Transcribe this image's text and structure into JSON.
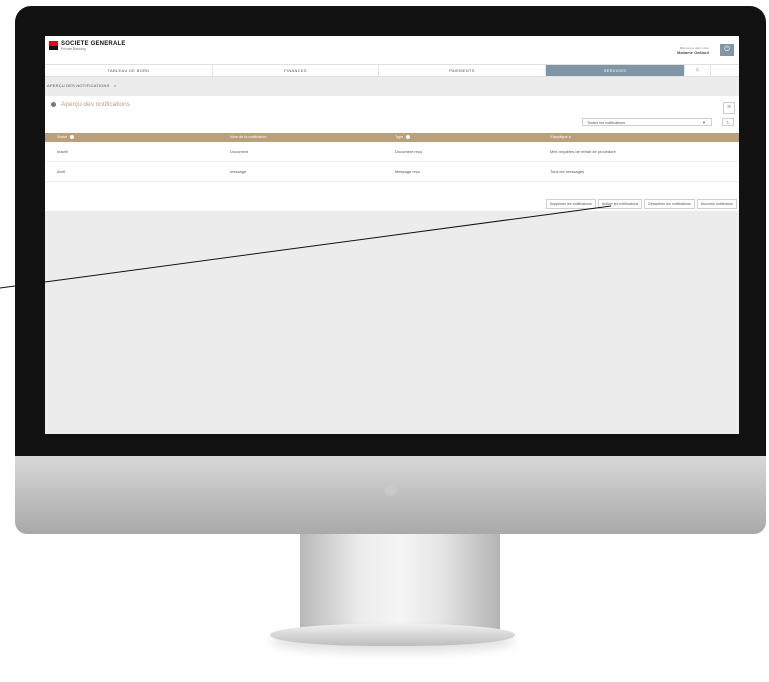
{
  "brand": {
    "name": "SOCIETE GENERALE",
    "subtitle": "Private Banking",
    "accent": "#e2001a"
  },
  "user": {
    "greeting": "Bienvenue dans votre",
    "name": "Madame Gaillard"
  },
  "nav": {
    "tabs": [
      {
        "label": "TABLEAU DE BORD",
        "active": false
      },
      {
        "label": "FINANCES",
        "active": false
      },
      {
        "label": "PAIEMENTS",
        "active": false
      },
      {
        "label": "SERVICES",
        "active": true
      }
    ],
    "home_icon": "home-icon",
    "active_color": "#7f96a6"
  },
  "breadcrumb": {
    "text": "APERÇU DES NOTIFICATIONS",
    "separator": ">"
  },
  "card": {
    "title": "Aperçu des notifications",
    "filter_value": "Toutes les notifications"
  },
  "table": {
    "header_color": "#b9a07a",
    "columns": [
      "Statut",
      "Nom de la notification",
      "Type",
      "S'applique à"
    ],
    "rows": [
      [
        "Inactif",
        "Document",
        "Document reçu",
        "Mes requêtes de retrait de procédure"
      ],
      [
        "Actif",
        "message",
        "Message reçu",
        "Tous les messages"
      ]
    ]
  },
  "actions": [
    "Supprimer les notifications",
    "Activer les notifications",
    "Désactiver les notifications",
    "Nouvelle notification"
  ]
}
